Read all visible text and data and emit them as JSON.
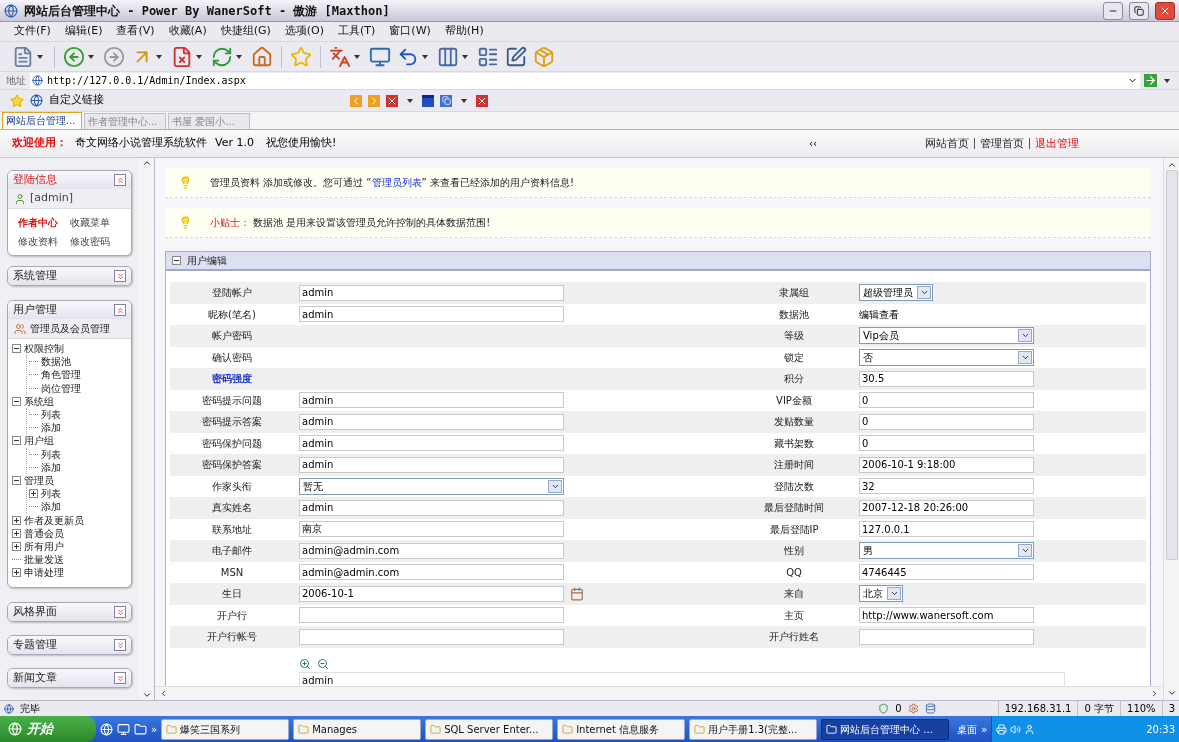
{
  "window": {
    "title": "网站后台管理中心 - Power By WanerSoft - 傲游 [Maxthon]"
  },
  "menu": [
    "文件(F)",
    "编辑(E)",
    "查看(V)",
    "收藏(A)",
    "快捷组(G)",
    "选项(O)",
    "工具(T)",
    "窗口(W)",
    "帮助(H)"
  ],
  "address": {
    "label": "地址",
    "url": "http://127.0.0.1/Admin/Index.aspx"
  },
  "links_bar": {
    "link": "自定义链接"
  },
  "browser_tabs": [
    {
      "label": "网站后台管理...",
      "selected": true
    },
    {
      "label": "作者管理中心...",
      "selected": false
    },
    {
      "label": "书屋 爱国小...",
      "selected": false
    }
  ],
  "header": {
    "welcome_label": "欢迎使用：",
    "app_name": "奇文网络小说管理系统软件",
    "version": "Ver 1.0",
    "greeting": "祝您使用愉快!",
    "collapse": "‹‹",
    "links": [
      {
        "label": "网站首页",
        "kind": "normal"
      },
      {
        "label": "管理首页",
        "kind": "normal"
      },
      {
        "label": "退出管理",
        "kind": "danger"
      }
    ]
  },
  "sidebar": [
    {
      "title": "登陆信息",
      "kind": "login",
      "expanded": true,
      "user": "[admin]",
      "links": [
        {
          "label": "作者中心",
          "kind": "highlight"
        },
        {
          "label": "收藏菜单",
          "kind": "normal"
        },
        {
          "label": "修改资料",
          "kind": "normal"
        },
        {
          "label": "修改密码",
          "kind": "normal"
        }
      ]
    },
    {
      "title": "系统管理",
      "kind": "menu",
      "expanded": false
    },
    {
      "title": "用户管理",
      "kind": "tree",
      "expanded": true,
      "subtitle": "管理员及会员管理",
      "tree": [
        {
          "label": "权限控制",
          "kind": "folder",
          "expanded": true,
          "children": [
            {
              "label": "数据池",
              "kind": "leaf"
            },
            {
              "label": "角色管理",
              "kind": "leaf"
            },
            {
              "label": "岗位管理",
              "kind": "leaf"
            }
          ]
        },
        {
          "label": "系统组",
          "kind": "folder",
          "expanded": true,
          "children": [
            {
              "label": "列表",
              "kind": "leaf"
            },
            {
              "label": "添加",
              "kind": "leaf"
            }
          ]
        },
        {
          "label": "用户组",
          "kind": "folder",
          "expanded": true,
          "children": [
            {
              "label": "列表",
              "kind": "leaf"
            },
            {
              "label": "添加",
              "kind": "leaf"
            }
          ]
        },
        {
          "label": "管理员",
          "kind": "folder",
          "expanded": true,
          "children": [
            {
              "label": "列表",
              "kind": "folder",
              "expanded": false
            },
            {
              "label": "添加",
              "kind": "leaf"
            }
          ]
        },
        {
          "label": "作者及更新员",
          "kind": "folder",
          "expanded": false
        },
        {
          "label": "普通会员",
          "kind": "folder",
          "expanded": false
        },
        {
          "label": "所有用户",
          "kind": "folder",
          "expanded": false
        },
        {
          "label": "批量发送",
          "kind": "leaf"
        },
        {
          "label": "申请处理",
          "kind": "folder",
          "expanded": false
        }
      ]
    },
    {
      "title": "风格界面",
      "kind": "menu",
      "expanded": false
    },
    {
      "title": "专题管理",
      "kind": "menu",
      "expanded": false
    },
    {
      "title": "新闻文章",
      "kind": "menu",
      "expanded": false
    }
  ],
  "notices": [
    {
      "parts": [
        {
          "kind": "plain",
          "text": "管理员资料 添加或修改。您可通过 “"
        },
        {
          "kind": "link",
          "text": "管理员列表"
        },
        {
          "kind": "plain",
          "text": "” 来查看已经添加的用户资料信息!"
        }
      ]
    },
    {
      "parts": [
        {
          "kind": "label",
          "text": "小贴士："
        },
        {
          "kind": "plain",
          "text": " 数据池 是用来设置该管理员允许控制的具体数据范围!"
        }
      ]
    }
  ],
  "form": {
    "title": "用户编辑",
    "rows": [
      {
        "left": {
          "label": "登陆帐户",
          "kind": "input",
          "value": "admin"
        },
        "right": {
          "label": "隶属组",
          "kind": "short-select",
          "value": "超级管理员"
        }
      },
      {
        "left": {
          "label": "昵称(笔名)",
          "kind": "input",
          "value": "admin"
        },
        "right": {
          "label": "数据池",
          "kind": "text",
          "value": "编辑查看"
        }
      },
      {
        "left": {
          "label": "帐户密码",
          "kind": "blank"
        },
        "right": {
          "label": "等级",
          "kind": "select",
          "value": "Vip会员"
        }
      },
      {
        "left": {
          "label": "确认密码",
          "kind": "blank"
        },
        "right": {
          "label": "锁定",
          "kind": "select",
          "value": "否"
        }
      },
      {
        "left": {
          "label": "密码强度",
          "kind": "link"
        },
        "right": {
          "label": "积分",
          "kind": "input",
          "value": "30.5"
        }
      },
      {
        "left": {
          "label": "密码提示问题",
          "kind": "input",
          "value": "admin"
        },
        "right": {
          "label": "VIP金额",
          "kind": "input",
          "value": "0"
        }
      },
      {
        "left": {
          "label": "密码提示答案",
          "kind": "input",
          "value": "admin"
        },
        "right": {
          "label": "发贴数量",
          "kind": "input",
          "value": "0"
        }
      },
      {
        "left": {
          "label": "密码保护问题",
          "kind": "input",
          "value": "admin"
        },
        "right": {
          "label": "藏书架数",
          "kind": "input",
          "value": "0"
        }
      },
      {
        "left": {
          "label": "密码保护答案",
          "kind": "input",
          "value": "admin"
        },
        "right": {
          "label": "注册时间",
          "kind": "input",
          "value": "2006-10-1 9:18:00"
        }
      },
      {
        "left": {
          "label": "作家头衔",
          "kind": "select",
          "value": "暂无"
        },
        "right": {
          "label": "登陆次数",
          "kind": "input",
          "value": "32"
        }
      },
      {
        "left": {
          "label": "真实姓名",
          "kind": "input",
          "value": "admin"
        },
        "right": {
          "label": "最后登陆时间",
          "kind": "input",
          "value": "2007-12-18 20:26:00"
        }
      },
      {
        "left": {
          "label": "联系地址",
          "kind": "input",
          "value": "南京"
        },
        "right": {
          "label": "最后登陆IP",
          "kind": "input",
          "value": "127.0.0.1"
        }
      },
      {
        "left": {
          "label": "电子邮件",
          "kind": "input",
          "value": "admin@admin.com"
        },
        "right": {
          "label": "性别",
          "kind": "select",
          "value": "男"
        }
      },
      {
        "left": {
          "label": "MSN",
          "kind": "input",
          "value": "admin@admin.com"
        },
        "right": {
          "label": "QQ",
          "kind": "input",
          "value": "4746445"
        }
      },
      {
        "left": {
          "label": "生日",
          "kind": "date",
          "value": "2006-10-1"
        },
        "right": {
          "label": "来自",
          "kind": "short-select",
          "value": "北京"
        }
      },
      {
        "left": {
          "label": "开户行",
          "kind": "input"
        },
        "right": {
          "label": "主页",
          "kind": "input",
          "value": "http://www.wanersoft.com"
        }
      },
      {
        "left": {
          "label": "开户行帐号",
          "kind": "input"
        },
        "right": {
          "label": "开户行姓名",
          "kind": "input"
        }
      }
    ],
    "editor": {
      "value": "admin"
    }
  },
  "status_bar": {
    "text": "完毕",
    "counter": "0",
    "ip": "192.168.31.1",
    "bytes": "0 字节",
    "zoom": "110%",
    "count": "3"
  },
  "taskbar": {
    "start": "开始",
    "quick_more": "»",
    "tasks": [
      {
        "label": "爆笑三国系列",
        "selected": false
      },
      {
        "label": "Manages",
        "selected": false
      },
      {
        "label": "SQL Server Enter...",
        "selected": false
      },
      {
        "label": "Internet 信息服务",
        "selected": false
      },
      {
        "label": "用户手册1.3(完整...",
        "selected": false
      },
      {
        "label": "网站后台管理中心 ...",
        "selected": true
      }
    ],
    "desktop": "桌面",
    "tray_more": "»",
    "clock": "20:33"
  }
}
